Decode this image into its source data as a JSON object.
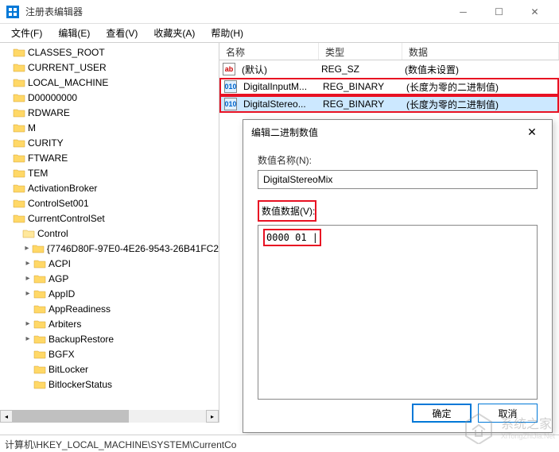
{
  "window": {
    "title": "注册表编辑器"
  },
  "menu": {
    "file": "文件(F)",
    "edit": "编辑(E)",
    "view": "查看(V)",
    "favorites": "收藏夹(A)",
    "help": "帮助(H)"
  },
  "tree": {
    "items": [
      {
        "label": "CLASSES_ROOT",
        "indent": 0,
        "expand": ""
      },
      {
        "label": "CURRENT_USER",
        "indent": 0,
        "expand": ""
      },
      {
        "label": "LOCAL_MACHINE",
        "indent": 0,
        "expand": ""
      },
      {
        "label": "D00000000",
        "indent": 0,
        "expand": ""
      },
      {
        "label": "RDWARE",
        "indent": 0,
        "expand": ""
      },
      {
        "label": "M",
        "indent": 0,
        "expand": ""
      },
      {
        "label": "CURITY",
        "indent": 0,
        "expand": ""
      },
      {
        "label": "FTWARE",
        "indent": 0,
        "expand": ""
      },
      {
        "label": "TEM",
        "indent": 0,
        "expand": ""
      },
      {
        "label": "ActivationBroker",
        "indent": 0,
        "expand": ""
      },
      {
        "label": "ControlSet001",
        "indent": 0,
        "expand": ""
      },
      {
        "label": "CurrentControlSet",
        "indent": 0,
        "expand": ""
      },
      {
        "label": "Control",
        "indent": 1,
        "expand": "",
        "open": true
      },
      {
        "label": "{7746D80F-97E0-4E26-9543-26B41FC2",
        "indent": 2,
        "expand": "▸"
      },
      {
        "label": "ACPI",
        "indent": 2,
        "expand": "▸"
      },
      {
        "label": "AGP",
        "indent": 2,
        "expand": "▸"
      },
      {
        "label": "AppID",
        "indent": 2,
        "expand": "▸"
      },
      {
        "label": "AppReadiness",
        "indent": 2,
        "expand": ""
      },
      {
        "label": "Arbiters",
        "indent": 2,
        "expand": "▸"
      },
      {
        "label": "BackupRestore",
        "indent": 2,
        "expand": "▸"
      },
      {
        "label": "BGFX",
        "indent": 2,
        "expand": ""
      },
      {
        "label": "BitLocker",
        "indent": 2,
        "expand": ""
      },
      {
        "label": "BitlockerStatus",
        "indent": 2,
        "expand": ""
      }
    ]
  },
  "list": {
    "header": {
      "name": "名称",
      "type": "类型",
      "data": "数据"
    },
    "rows": [
      {
        "icon": "ab",
        "iconClass": "icon-sz",
        "name": "(默认)",
        "type": "REG_SZ",
        "data": "(数值未设置)",
        "selected": false,
        "redbox": false
      },
      {
        "icon": "010",
        "iconClass": "icon-bin",
        "name": "DigitalInputM...",
        "type": "REG_BINARY",
        "data": "(长度为零的二进制值)",
        "selected": false,
        "redbox": true
      },
      {
        "icon": "010",
        "iconClass": "icon-bin",
        "name": "DigitalStereo...",
        "type": "REG_BINARY",
        "data": "(长度为零的二进制值)",
        "selected": true,
        "redbox": true
      }
    ]
  },
  "dialog": {
    "title": "编辑二进制数值",
    "name_label": "数值名称(N):",
    "name_value": "DigitalStereoMix",
    "data_label": "数值数据(V):",
    "hex_text": "0000  01",
    "ok": "确定",
    "cancel": "取消"
  },
  "statusbar": {
    "path": "计算机\\HKEY_LOCAL_MACHINE\\SYSTEM\\CurrentCo"
  },
  "watermark": {
    "text": "系统之家",
    "sub": "XiTongZhiJia.Net"
  }
}
